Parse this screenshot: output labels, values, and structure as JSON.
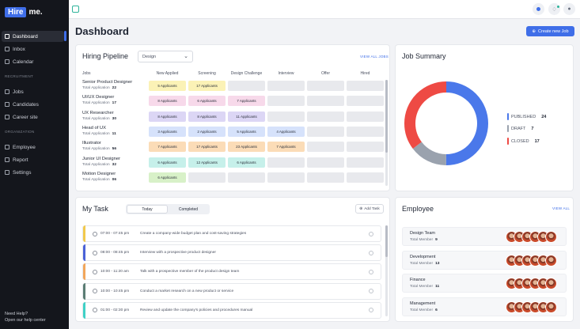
{
  "brand": {
    "logo_box": "Hire",
    "logo_text": "me."
  },
  "sidebar": {
    "main_items": [
      {
        "label": "Dashboard"
      },
      {
        "label": "Inbox"
      },
      {
        "label": "Calendar"
      }
    ],
    "recruitment_label": "RECRUITMENT",
    "recruitment_items": [
      {
        "label": "Jobs"
      },
      {
        "label": "Candidates"
      },
      {
        "label": "Career site"
      }
    ],
    "organization_label": "ORGANIZATION",
    "organization_items": [
      {
        "label": "Employee"
      },
      {
        "label": "Report"
      },
      {
        "label": "Settings"
      }
    ],
    "help_title": "Need Help?",
    "help_link": "Open our help center"
  },
  "page": {
    "title": "Dashboard",
    "create_button": "Create new Job"
  },
  "pipeline": {
    "title": "Hiring Pipeline",
    "select_value": "Design",
    "view_all": "VIEW ALL JOBS",
    "jobs_header": "Jobs",
    "total_label": "Total Application",
    "stages": [
      "New Applied",
      "Screening",
      "Design Challenge",
      "Interview",
      "Offer",
      "Hired"
    ],
    "jobs": [
      {
        "title": "Senior Product Designer",
        "total": "22",
        "cells": [
          "5 Applicants",
          "17 Applicants",
          "",
          "",
          "",
          ""
        ]
      },
      {
        "title": "UI/UX Designer",
        "total": "17",
        "cells": [
          "8 Applicants",
          "6 Applicants",
          "7 Applicants",
          "",
          "",
          ""
        ]
      },
      {
        "title": "UX Researcher",
        "total": "30",
        "cells": [
          "8 Applicants",
          "8 Applicants",
          "11 Applicants",
          "",
          "",
          ""
        ]
      },
      {
        "title": "Head of UX",
        "total": "11",
        "cells": [
          "3 Applicants",
          "2 Applicants",
          "5 Applicants",
          "4 Applicants",
          "",
          ""
        ]
      },
      {
        "title": "Illustrator",
        "total": "56",
        "cells": [
          "7 Applicants",
          "17 Applicants",
          "23 Applicants",
          "7 Applicants",
          "",
          ""
        ]
      },
      {
        "title": "Junior UI Designer",
        "total": "32",
        "cells": [
          "6 Applicants",
          "12 Applicants",
          "6 Applicants",
          "",
          "",
          ""
        ]
      },
      {
        "title": "Motion Designer",
        "total": "06",
        "cells": [
          "6 Applicants",
          "",
          "",
          "",
          "",
          ""
        ]
      }
    ],
    "stage_colors": [
      "#fbf2b6",
      "#f7d9ea",
      "#dcd6f5",
      "#d6e2fb",
      "#fbdcb7",
      "#c6f0ea",
      "#d8f1c8"
    ]
  },
  "job_summary": {
    "title": "Job Summary",
    "items": [
      {
        "label": "PUBLISHED",
        "value": 24,
        "color": "#4a78ea"
      },
      {
        "label": "DRAFT",
        "value": 7,
        "color": "#9aa2ae"
      },
      {
        "label": "CLOSED",
        "value": 17,
        "color": "#ee4a44"
      }
    ]
  },
  "tasks": {
    "title": "My Task",
    "tabs": [
      "Today",
      "Completed"
    ],
    "add_label": "Add Task",
    "items": [
      {
        "time": "07:00 - 07:45 pm",
        "desc": "Create a company-wide budget plan and cost-saving strategies",
        "color": "#f2c94c"
      },
      {
        "time": "08:00 - 08:45 pm",
        "desc": "Interview with a prospective product designer",
        "color": "#4a62d8"
      },
      {
        "time": "10:00 - 11:20 am",
        "desc": "Talk with a prospective member of the product design team",
        "color": "#f2a65a"
      },
      {
        "time": "10:00 - 10:45 pm",
        "desc": "Conduct a market research on a new product or service",
        "color": "#5b7d74"
      },
      {
        "time": "01:00 - 02:30 pm",
        "desc": "Review and update the company's policies and procedures manual",
        "color": "#3fd1c6"
      }
    ]
  },
  "employee": {
    "title": "Employee",
    "view_all": "VIEW ALL",
    "total_label": "Total Member",
    "groups": [
      {
        "name": "Design Team",
        "total": "9"
      },
      {
        "name": "Development",
        "total": "13"
      },
      {
        "name": "Finance",
        "total": "11"
      },
      {
        "name": "Management",
        "total": "6"
      }
    ]
  }
}
